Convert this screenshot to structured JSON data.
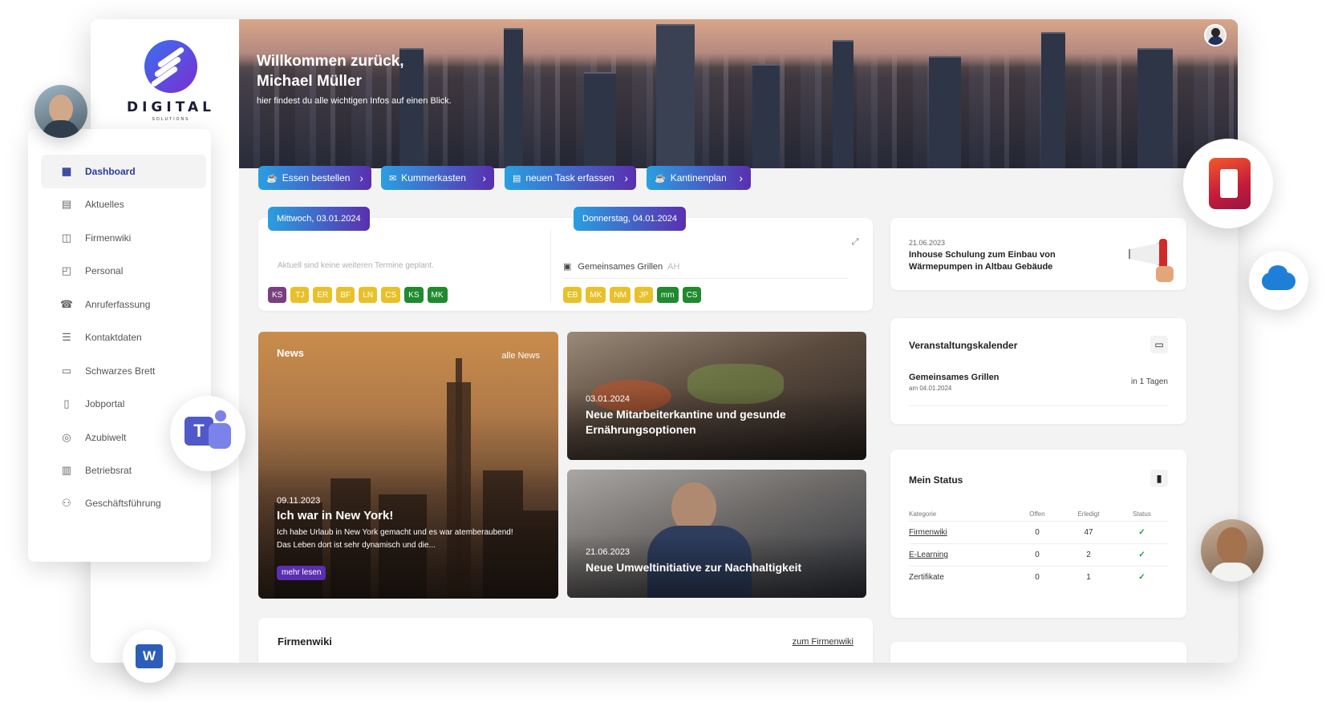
{
  "brand": {
    "name": "DIGITAL",
    "tagline": "SOLUTIONS"
  },
  "hero": {
    "title_line1": "Willkommen zurück,",
    "title_line2": "Michael Müller",
    "subtitle": "hier findest du alle wichtigen Infos auf einen Blick."
  },
  "quick_actions": [
    {
      "label": "Essen bestellen",
      "icon": "food-icon"
    },
    {
      "label": "Kummerkasten",
      "icon": "chat-icon"
    },
    {
      "label": "neuen Task erfassen",
      "icon": "task-icon"
    },
    {
      "label": "Kantinenplan",
      "icon": "canteen-icon"
    }
  ],
  "nav": {
    "items": [
      {
        "label": "Dashboard",
        "icon": "grid-icon",
        "active": true
      },
      {
        "label": "Aktuelles",
        "icon": "newspaper-icon"
      },
      {
        "label": "Firmenwiki",
        "icon": "book-icon"
      },
      {
        "label": "Personal",
        "icon": "personal-icon"
      },
      {
        "label": "Anruferfassung",
        "icon": "phone-icon"
      },
      {
        "label": "Kontaktdaten",
        "icon": "contacts-icon"
      },
      {
        "label": "Schwarzes Brett",
        "icon": "board-icon"
      },
      {
        "label": "Jobportal",
        "icon": "clipboard-icon"
      },
      {
        "label": "Azubiwelt",
        "icon": "globe-icon"
      },
      {
        "label": "Betriebsrat",
        "icon": "council-icon"
      },
      {
        "label": "Geschäftsführung",
        "icon": "people-icon"
      }
    ]
  },
  "calendar": {
    "day1": {
      "label": "Mittwoch, 03.01.2024",
      "empty_text": "Aktuell sind keine weiteren Termine geplant.",
      "chips": [
        {
          "text": "KS",
          "color": "#7a3f7e"
        },
        {
          "text": "TJ",
          "color": "#e8c12a"
        },
        {
          "text": "ER",
          "color": "#e8c12a"
        },
        {
          "text": "BF",
          "color": "#e8c12a"
        },
        {
          "text": "LN",
          "color": "#e8c12a"
        },
        {
          "text": "CS",
          "color": "#e8c12a"
        },
        {
          "text": "KS",
          "color": "#1f8a2e"
        },
        {
          "text": "MK",
          "color": "#1f8a2e"
        }
      ]
    },
    "day2": {
      "label": "Donnerstag, 04.01.2024",
      "event": "Gemeinsames Grillen",
      "event_initials": "AH",
      "chips": [
        {
          "text": "EB",
          "color": "#e8c12a"
        },
        {
          "text": "MK",
          "color": "#e8c12a"
        },
        {
          "text": "NM",
          "color": "#e8c12a"
        },
        {
          "text": "JP",
          "color": "#e8c12a"
        },
        {
          "text": "mm",
          "color": "#1f8a2e"
        },
        {
          "text": "CS",
          "color": "#1f8a2e"
        }
      ]
    }
  },
  "news": {
    "heading": "News",
    "all_link": "alle News",
    "featured": {
      "date": "09.11.2023",
      "title": "Ich war in New York!",
      "excerpt": "Ich habe Urlaub in New York gemacht und es war atemberaubend! Das Leben dort ist sehr dynamisch und die...",
      "more": "mehr lesen"
    },
    "item2": {
      "date": "03.01.2024",
      "title": "Neue Mitarbeiterkantine und gesunde Ernährungsoptionen"
    },
    "item3": {
      "date": "21.06.2023",
      "title": "Neue Umweltinitiative zur Nachhaltigkeit"
    }
  },
  "firmenwiki": {
    "heading": "Firmenwiki",
    "link": "zum Firmenwiki"
  },
  "announcement": {
    "date": "21.06.2023",
    "title": "Inhouse Schulung zum Einbau von Wärmepumpen in Altbau Gebäude"
  },
  "events": {
    "heading": "Veranstaltungskalender",
    "item": {
      "title": "Gemeinsames Grillen",
      "date": "am 04.01.2024",
      "relative": "in 1 Tagen"
    }
  },
  "status": {
    "heading": "Mein Status",
    "columns": [
      "Kategorie",
      "Offen",
      "Erledigt",
      "Status"
    ],
    "rows": [
      {
        "category": "Firmenwiki",
        "open": "0",
        "done": "47",
        "status": "✓"
      },
      {
        "category": "E-Learning",
        "open": "0",
        "done": "2",
        "status": "✓"
      },
      {
        "category": "Zertifikate",
        "open": "0",
        "done": "1",
        "status": "✓"
      }
    ]
  },
  "colors": {
    "accent_from": "#2a9fe0",
    "accent_to": "#5a2fb0",
    "nav_active": "#2b3a9a",
    "check": "#1f9a3a"
  }
}
